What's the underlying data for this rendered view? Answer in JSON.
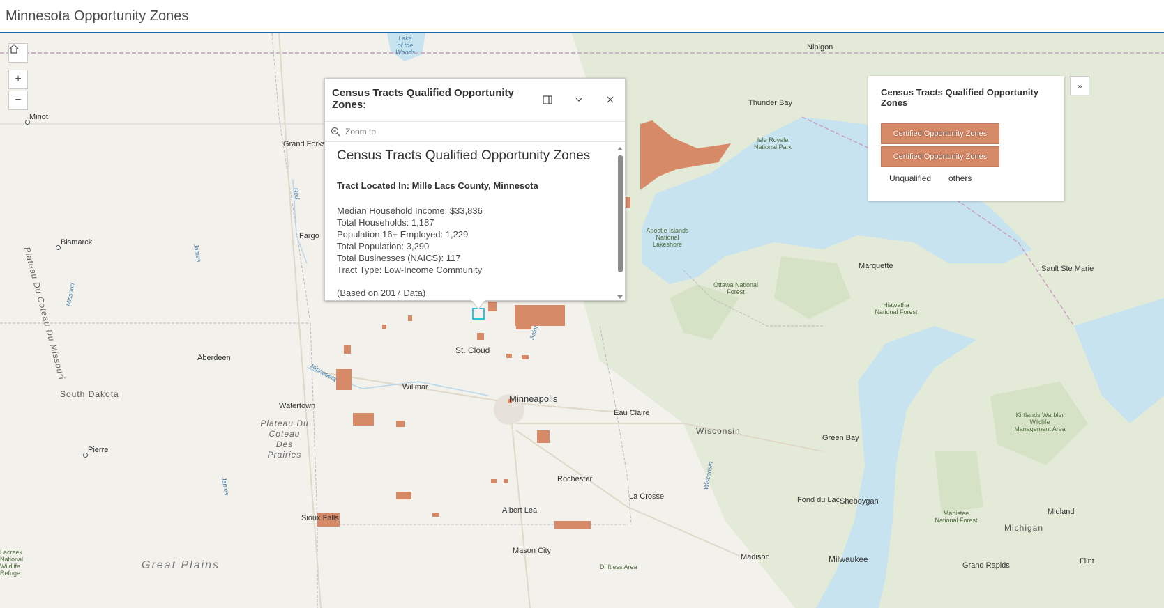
{
  "app": {
    "title": "Minnesota Opportunity Zones"
  },
  "controls": {
    "home_icon": "home-icon",
    "zoom_in": "+",
    "zoom_out": "−",
    "expand": "»"
  },
  "popup": {
    "header_title": "Census Tracts Qualified Opportunity Zones:",
    "zoom_to": "Zoom to",
    "content_title": "Census Tracts Qualified Opportunity Zones",
    "location": "Tract Located In: Mille Lacs County, Minnesota",
    "fields": [
      "Median Household Income: $33,836",
      "Total Households: 1,187",
      "Population 16+ Employed: 1,229",
      "Total Population: 3,290",
      "Total Businesses (NAICS): 117",
      "Tract Type: Low-Income Community"
    ],
    "note": "(Based on 2017 Data)"
  },
  "legend": {
    "title": "Census Tracts Qualified Opportunity Zones",
    "items": [
      "Certified Opportunity Zones",
      "Certified Opportunity Zones"
    ],
    "unqualified": "Unqualified",
    "others": "others",
    "color": "#d68a68"
  },
  "map_labels": {
    "cities": [
      "Minot",
      "Grand Forks",
      "Bismarck",
      "Fargo",
      "Aberdeen",
      "Watertown",
      "Pierre",
      "Sioux Falls",
      "St. Cloud",
      "Willmar",
      "Minneapolis",
      "Rochester",
      "Albert Lea",
      "Mason City",
      "Eau Claire",
      "La Crosse",
      "Madison",
      "Milwaukee",
      "Green Bay",
      "Sheboygan",
      "Fond du Lac",
      "Marquette",
      "Sault Ste Marie",
      "Thunder Bay",
      "Nipigon",
      "Midland",
      "Grand Rapids",
      "Flint"
    ],
    "states": [
      "South Dakota",
      "Wisconsin",
      "Michigan"
    ],
    "regions": [
      "Plateau Du Coteau Du Missouri",
      "Plateau Du Coteau Des Prairies",
      "Great Plains"
    ],
    "waters": [
      "Lake of the Woods",
      "Red",
      "James",
      "Missouri",
      "Minnesota",
      "Saint",
      "Wisconsin",
      "James"
    ],
    "parks": [
      "Isle Royale National Park",
      "Apostle Islands National Lakeshore",
      "Ottawa National Forest",
      "Hiawatha National Forest",
      "Kirtlands Warbler Wildlife Management Area",
      "Manistee National Forest",
      "Driftless Area",
      "Lacreek National Wildlife Refuge"
    ]
  }
}
